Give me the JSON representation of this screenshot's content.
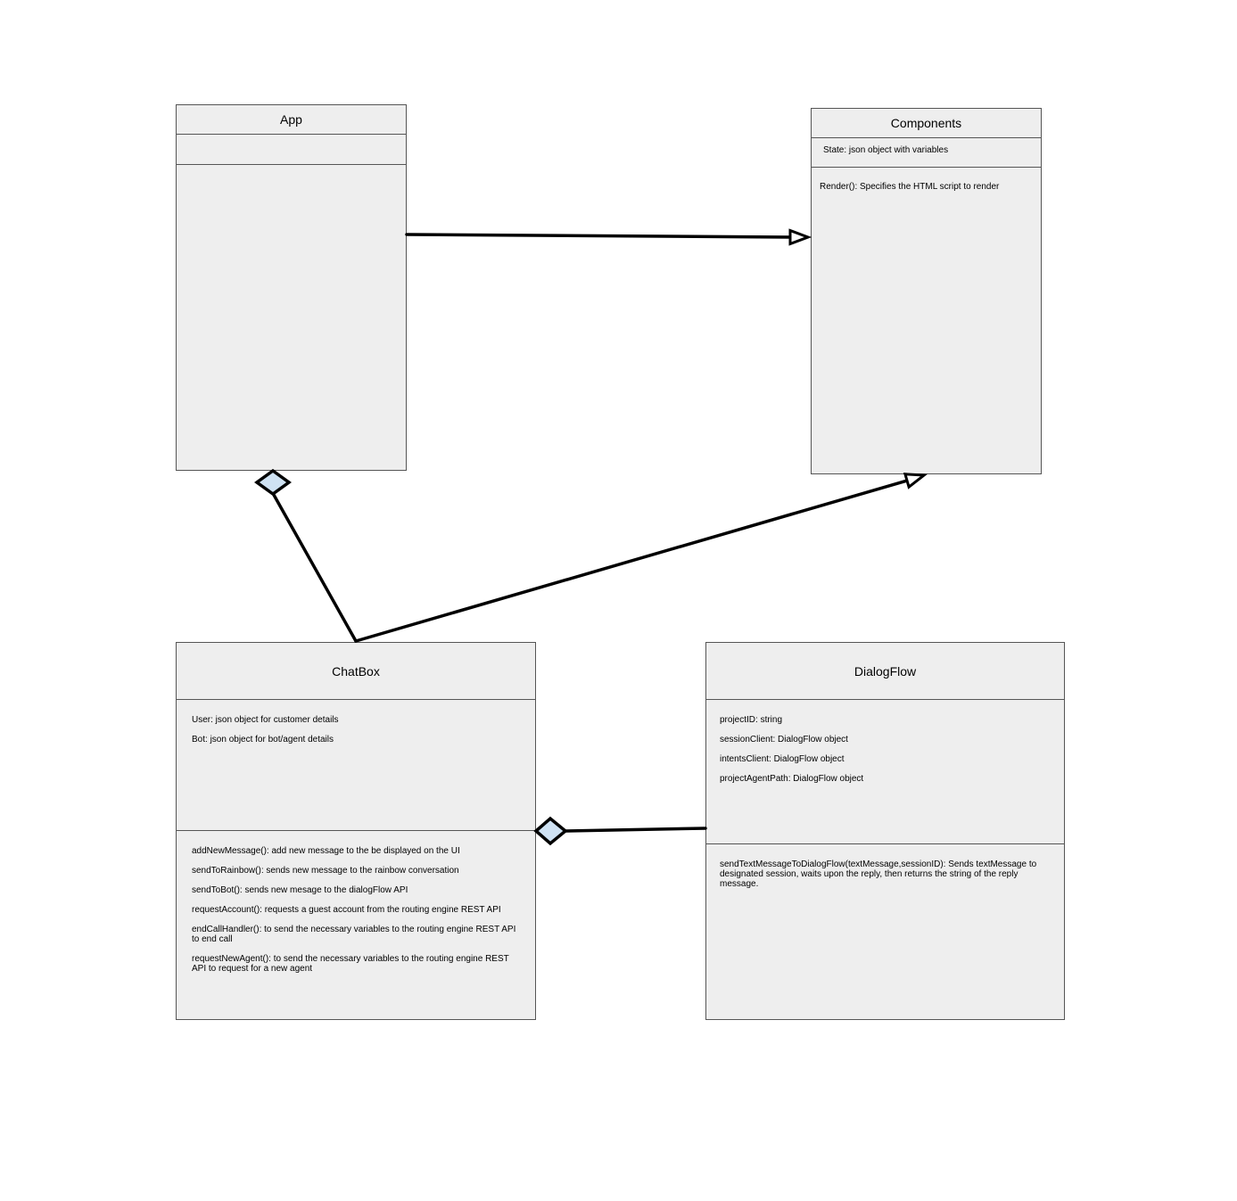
{
  "colors": {
    "class_fill": "#eeeeee",
    "class_border": "#555555",
    "connector": "#000000",
    "diamond_fill": "#cfe2f3",
    "arrowhead_fill": "#ffffff"
  },
  "classes": {
    "app": {
      "name": "App",
      "attributes": [],
      "methods": []
    },
    "components": {
      "name": "Components",
      "attributes": [
        "State: json object with variables"
      ],
      "methods": [
        "Render(): Specifies the HTML script to render"
      ]
    },
    "chatbox": {
      "name": "ChatBox",
      "attributes": [
        "User: json object for customer details",
        "Bot: json object for bot/agent details"
      ],
      "methods": [
        "addNewMessage(): add new message to the be displayed on the UI",
        "sendToRainbow(): sends new message to the rainbow conversation",
        "sendToBot(): sends new mesage to the dialogFlow API",
        "requestAccount(): requests a guest account from the routing engine REST API",
        "endCallHandler(): to send the necessary variables to the routing engine REST API to end call",
        "requestNewAgent(): to send the necessary variables to the routing engine REST API to request for a new agent"
      ]
    },
    "dialogflow": {
      "name": "DialogFlow",
      "attributes": [
        "projectID: string",
        "sessionClient: DialogFlow object",
        "intentsClient: DialogFlow object",
        "projectAgentPath: DialogFlow object"
      ],
      "methods": [
        "sendTextMessageToDialogFlow(textMessage,sessionID): Sends textMessage to designated session, waits upon the reply, then returns the string of the reply message."
      ]
    }
  },
  "relationships": [
    {
      "from": "App",
      "to": "Components",
      "type": "generalization"
    },
    {
      "from": "ChatBox",
      "to": "Components",
      "type": "generalization"
    },
    {
      "from": "ChatBox",
      "to": "App",
      "type": "aggregation"
    },
    {
      "from": "DialogFlow",
      "to": "ChatBox",
      "type": "aggregation"
    }
  ]
}
